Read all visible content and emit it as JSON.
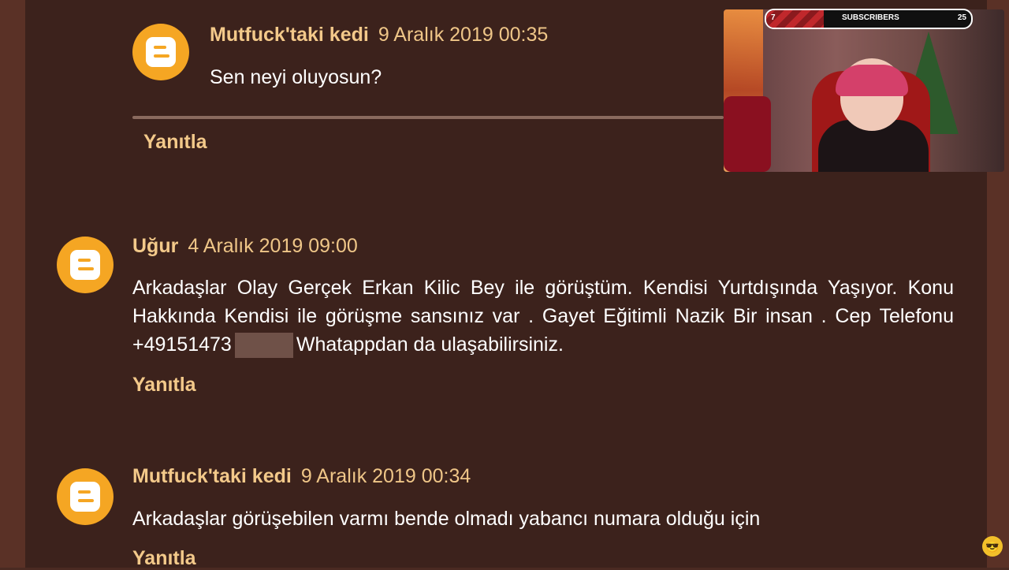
{
  "comments": [
    {
      "author": "Mutfuck'taki kedi",
      "date": "9 Aralık 2019 00:35",
      "text": "Sen neyi oluyosun?",
      "reply_label": "Yanıtla"
    },
    {
      "author": "Uğur",
      "date": "4 Aralık 2019 09:00",
      "text_line1": "Arkadaşlar Olay Gerçek Erkan Kilic Bey ile görüştüm. Kendisi Yurtdışında Yaşıyor. Konu",
      "text_line2": "Hakkında Kendisi ile görüşme sansınız var . Gayet Eğitimli Nazik Bir insan . Cep Telefonu",
      "phone_prefix": "+49151473",
      "text_line3_rest": "Whatappdan da ulaşabilirsiniz.",
      "reply_label": "Yanıtla"
    },
    {
      "author": "Mutfuck'taki kedi",
      "date": "9 Aralık 2019 00:34",
      "text": "Arkadaşlar görüşebilen varmı bende olmadı yabancı numara olduğu için",
      "reply_label": "Yanıtla"
    }
  ],
  "overlay": {
    "subscribers_label": "SUBSCRIBERS",
    "current": "7",
    "goal": "25",
    "progress_fraction": 0.28
  },
  "icons": {
    "avatar": "blogger-icon",
    "corner": "emote-icon"
  },
  "colors": {
    "background": "#3c221c",
    "author": "#f3c98a",
    "avatar": "#f5a623"
  }
}
